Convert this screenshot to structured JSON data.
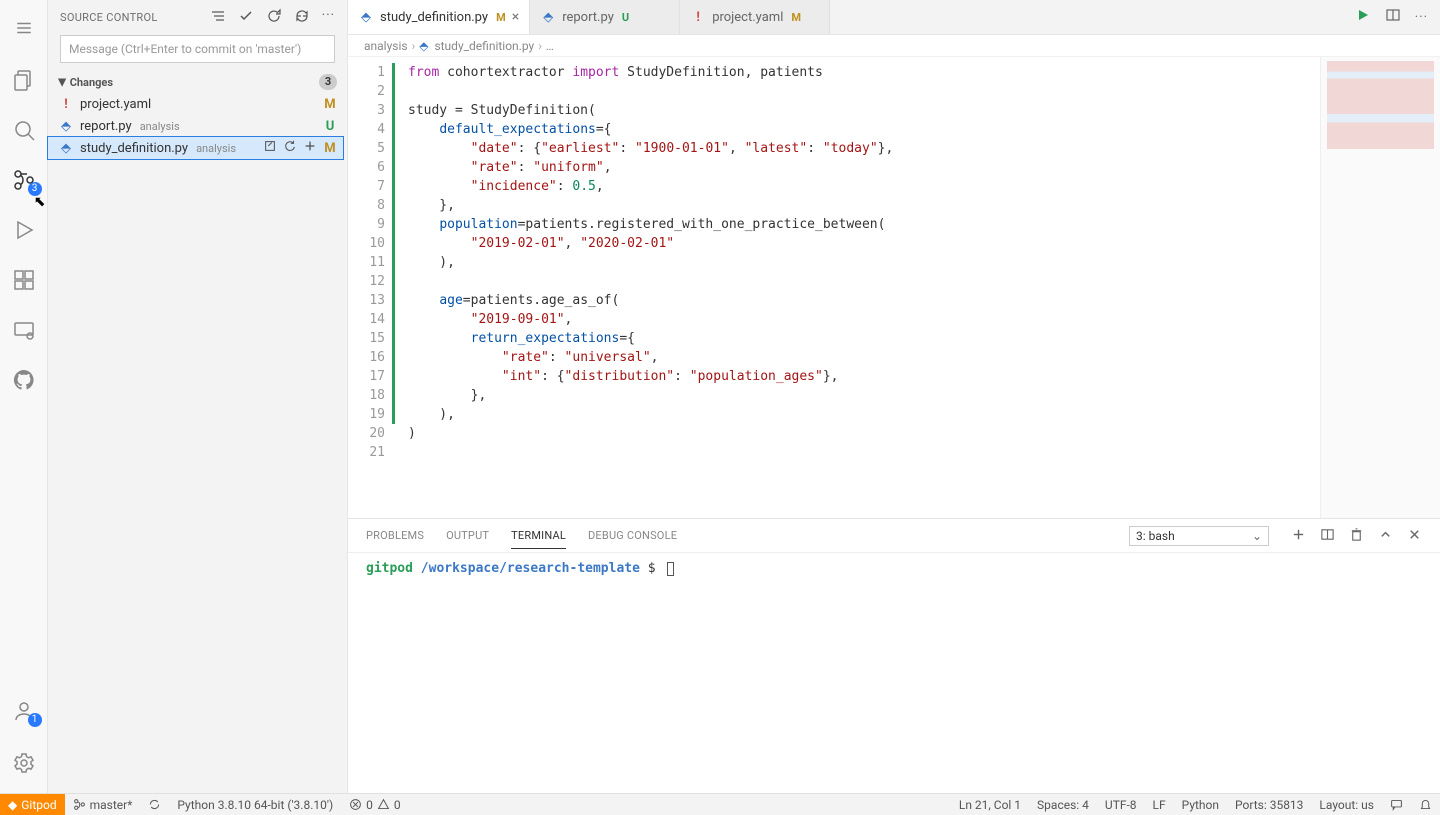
{
  "sidebar": {
    "title": "SOURCE CONTROL",
    "commit_placeholder": "Message (Ctrl+Enter to commit on 'master')",
    "changes": {
      "label": "Changes",
      "count": "3",
      "items": [
        {
          "icon": "!",
          "name": "project.yaml",
          "folder": "",
          "status": "M"
        },
        {
          "icon": "py",
          "name": "report.py",
          "folder": "analysis",
          "status": "U"
        },
        {
          "icon": "py",
          "name": "study_definition.py",
          "folder": "analysis",
          "status": "M"
        }
      ]
    }
  },
  "activity": {
    "scm_badge": "3",
    "account_badge": "1"
  },
  "tabs": [
    {
      "icon": "py",
      "label": "study_definition.py",
      "suffix": "M",
      "active": true,
      "closable": true
    },
    {
      "icon": "py",
      "label": "report.py",
      "suffix": "U",
      "active": false,
      "closable": false
    },
    {
      "icon": "!",
      "label": "project.yaml",
      "suffix": "M",
      "active": false,
      "closable": false
    }
  ],
  "breadcrumb": {
    "folder": "analysis",
    "file": "study_definition.py",
    "more": "…"
  },
  "code": {
    "line_count": 21,
    "lines_html": [
      "<span class='tok-kw'>from</span> cohortextractor <span class='tok-kw'>import</span> StudyDefinition, patients",
      "",
      "study = StudyDefinition(",
      "    <span class='tok-var'>default_expectations</span>={",
      "        <span class='tok-str'>\"date\"</span>: {<span class='tok-str'>\"earliest\"</span>: <span class='tok-str'>\"1900-01-01\"</span>, <span class='tok-str'>\"latest\"</span>: <span class='tok-str'>\"today\"</span>},",
      "        <span class='tok-str'>\"rate\"</span>: <span class='tok-str'>\"uniform\"</span>,",
      "        <span class='tok-str'>\"incidence\"</span>: <span class='tok-num'>0.5</span>,",
      "    },",
      "    <span class='tok-var'>population</span>=patients.registered_with_one_practice_between(",
      "        <span class='tok-str'>\"2019-02-01\"</span>, <span class='tok-str'>\"2020-02-01\"</span>",
      "    ),",
      "",
      "    <span class='tok-var'>age</span>=patients.age_as_of(",
      "        <span class='tok-str'>\"2019-09-01\"</span>,",
      "        <span class='tok-var'>return_expectations</span>={",
      "            <span class='tok-str'>\"rate\"</span>: <span class='tok-str'>\"universal\"</span>,",
      "            <span class='tok-str'>\"int\"</span>: {<span class='tok-str'>\"distribution\"</span>: <span class='tok-str'>\"population_ages\"</span>},",
      "        },",
      "    ),",
      ")",
      ""
    ]
  },
  "panel": {
    "tabs": [
      "PROBLEMS",
      "OUTPUT",
      "TERMINAL",
      "DEBUG CONSOLE"
    ],
    "active_tab": "TERMINAL",
    "terminal_selector": "3: bash",
    "prompt_user": "gitpod",
    "prompt_path": "/workspace/research-template",
    "prompt_symbol": "$"
  },
  "status": {
    "gitpod": "Gitpod",
    "branch": "master*",
    "python": "Python 3.8.10 64-bit ('3.8.10')",
    "errors": "0",
    "warnings": "0",
    "cursor": "Ln 21, Col 1",
    "spaces": "Spaces: 4",
    "encoding": "UTF-8",
    "eol": "LF",
    "language": "Python",
    "ports": "Ports: 35813",
    "layout": "Layout: us"
  }
}
